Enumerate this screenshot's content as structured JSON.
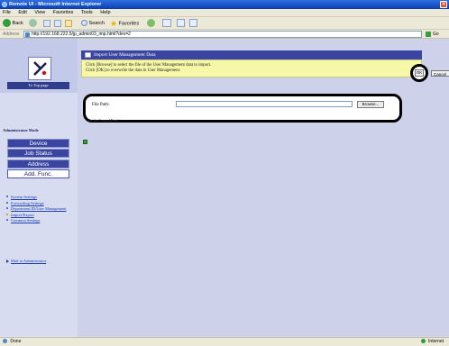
{
  "window": {
    "title": "Remote UI - Microsoft Internet Explorer"
  },
  "menu": [
    "File",
    "Edit",
    "View",
    "Favorites",
    "Tools",
    "Help"
  ],
  "toolbar": {
    "back": "Back",
    "search": "Search",
    "favorites": "Favorites"
  },
  "address": {
    "label": "Address",
    "url": "http://192.168.222.5/jp_admin03_imp.html?dev=2",
    "go": "Go"
  },
  "sidebar": {
    "to_top": "To Top page",
    "mode": "Administrator Mode",
    "nav": [
      "Device",
      "Job Status",
      "Address",
      "Add. Func."
    ],
    "sub_items": [
      "System Settings",
      "Forwarding Settings",
      "Department ID/User Management",
      "Import/Export",
      "Common Settings"
    ],
    "mail_link": "Mail to Administrator"
  },
  "page": {
    "header": "Import User Management Data",
    "instructions": [
      "Click [Browse] to select the file of the User Management data to import.",
      "Click [OK] to overwrite the data in User Management."
    ],
    "ok_label": "OK",
    "cancel_label": "Cancel",
    "file_path_label": "File Path:",
    "browse_label": "Browse...",
    "panel_note": "",
    "under_note": "for the Control Panel."
  },
  "status": {
    "left": "Done",
    "right": "Internet"
  }
}
